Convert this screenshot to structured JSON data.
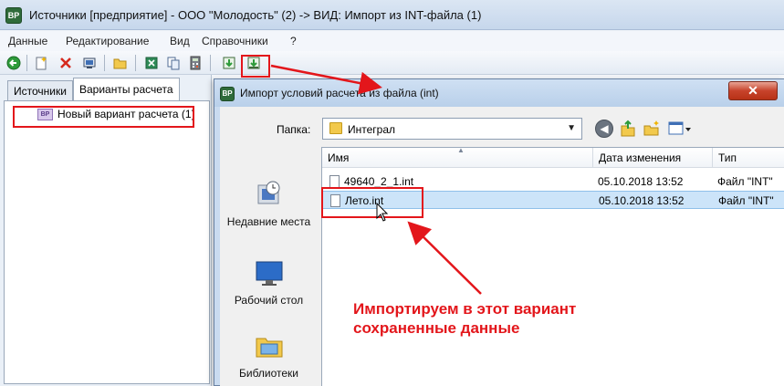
{
  "main_window": {
    "app_icon_text": "ВР",
    "title": "Источники [предприятие] - ООО \"Молодость\" (2) -> ВИД: Импорт из INT-файла (1)",
    "menu": [
      "Данные",
      "Редактирование",
      "Вид",
      "Справочники",
      "?"
    ]
  },
  "toolbar": {
    "buttons": [
      "refresh",
      "new",
      "delete",
      "properties",
      "open-folder",
      "export-excel",
      "copy",
      "calculator",
      "import-green",
      "import-int"
    ]
  },
  "left_panel": {
    "tabs": [
      "Источники",
      "Варианты расчета"
    ],
    "active_tab": "Варианты расчета",
    "tree_item": {
      "icon_text": "ВР",
      "label": "Новый вариант расчета (1)"
    }
  },
  "dialog": {
    "title": "Импорт условий расчета из файла (int)",
    "close_label": "✕",
    "folder_label": "Папка:",
    "folder_value": "Интеграл",
    "places": [
      {
        "label": "Недавние места",
        "icon": "recent-places-icon"
      },
      {
        "label": "Рабочий стол",
        "icon": "desktop-icon"
      },
      {
        "label": "Библиотеки",
        "icon": "libraries-icon"
      }
    ],
    "columns": {
      "name": "Имя",
      "date": "Дата изменения",
      "type": "Тип"
    },
    "files": [
      {
        "name": "49640_2_1.int",
        "date": "05.10.2018 13:52",
        "type": "Файл \"INT\""
      },
      {
        "name": "Лето.int",
        "date": "05.10.2018 13:52",
        "type": "Файл \"INT\""
      }
    ],
    "selected_file": "Лето.int"
  },
  "annotation": {
    "text": "Импортируем в этот вариант сохраненные данные",
    "color": "#e3161b"
  },
  "colors": {
    "selection": "#cce4f9",
    "annotation_red": "#e3161b",
    "close_button": "#c7432b"
  }
}
